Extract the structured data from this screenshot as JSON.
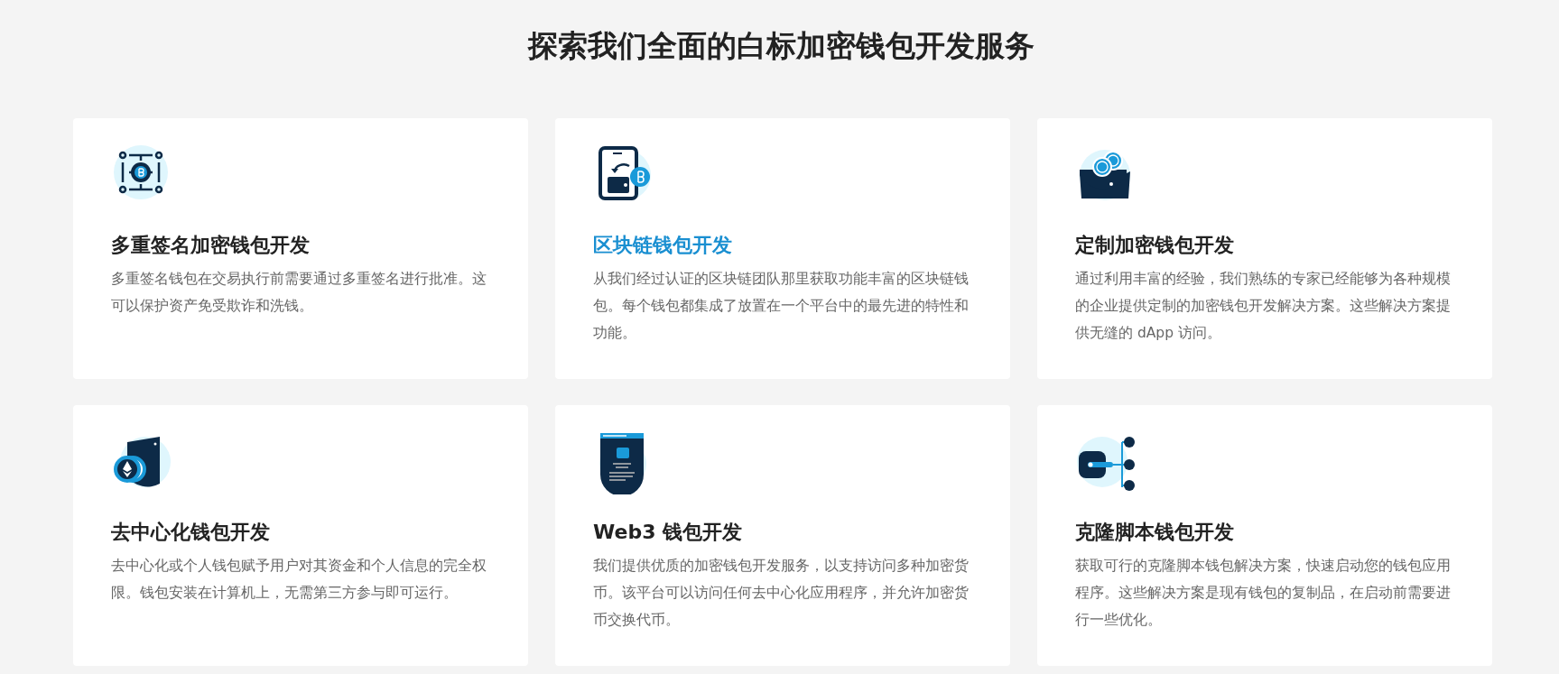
{
  "heading": "探索我们全面的白标加密钱包开发服务",
  "services": [
    {
      "title": "多重签名加密钱包开发",
      "highlighted": false,
      "description": "多重签名钱包在交易执行前需要通过多重签名进行批准。这可以保护资产免受欺诈和洗钱。"
    },
    {
      "title": "区块链钱包开发",
      "highlighted": true,
      "description": "从我们经过认证的区块链团队那里获取功能丰富的区块链钱包。每个钱包都集成了放置在一个平台中的最先进的特性和功能。"
    },
    {
      "title": "定制加密钱包开发",
      "highlighted": false,
      "description": "通过利用丰富的经验，我们熟练的专家已经能够为各种规模的企业提供定制的加密钱包开发解决方案。这些解决方案提供无缝的 dApp 访问。"
    },
    {
      "title": "去中心化钱包开发",
      "highlighted": false,
      "description": "去中心化或个人钱包赋予用户对其资金和个人信息的完全权限。钱包安装在计算机上，无需第三方参与即可运行。"
    },
    {
      "title": "Web3 钱包开发",
      "highlighted": false,
      "description": "我们提供优质的加密钱包开发服务，以支持访问多种加密货币。该平台可以访问任何去中心化应用程序，并允许加密货币交换代币。"
    },
    {
      "title": "克隆脚本钱包开发",
      "highlighted": false,
      "description": "获取可行的克隆脚本钱包解决方案，快速启动您的钱包应用程序。这些解决方案是现有钱包的复制品，在启动前需要进行一些优化。"
    }
  ]
}
